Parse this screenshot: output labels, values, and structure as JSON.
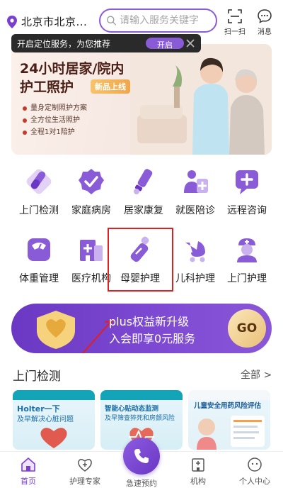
{
  "header": {
    "location": "北京市北京...",
    "search_placeholder": "请输入服务关键字",
    "scan_label": "扫一扫",
    "message_label": "消息"
  },
  "toast": {
    "text": "开启定位服务，为您推荐",
    "button_label": "开启"
  },
  "banner": {
    "title_line1": "24小时居家/院内",
    "title_line2": "护工照护",
    "badge": "新品上线",
    "bullets": [
      "量身定制照护方案",
      "全方位生活照护",
      "全程1对1陪护"
    ]
  },
  "services": [
    {
      "label": "上门检测",
      "icon": "test-tube-icon"
    },
    {
      "label": "家庭病房",
      "icon": "check-badge-icon"
    },
    {
      "label": "居家康复",
      "icon": "rehab-icon"
    },
    {
      "label": "就医陪诊",
      "icon": "escort-icon"
    },
    {
      "label": "远程咨询",
      "icon": "chat-plus-icon"
    },
    {
      "label": "体重管理",
      "icon": "scale-icon"
    },
    {
      "label": "医疗机构",
      "icon": "hospital-icon"
    },
    {
      "label": "母婴护理",
      "icon": "baby-bottle-icon"
    },
    {
      "label": "儿科护理",
      "icon": "stroller-icon"
    },
    {
      "label": "上门护理",
      "icon": "nurse-icon"
    }
  ],
  "plus_banner": {
    "line1": "plus权益新升级",
    "line2": "入会即享0元服务",
    "go_label": "GO"
  },
  "section": {
    "title": "上门检测",
    "more": "全部 >"
  },
  "cards": [
    {
      "title": "Holter一下",
      "subtitle": "及早解决心脏问题"
    },
    {
      "title": "智能心贴动态监测",
      "subtitle": "及早筛查猝死和房颤风险"
    },
    {
      "title": "儿童安全用药风险评估",
      "subtitle": ""
    }
  ],
  "nav": {
    "items": [
      "首页",
      "护理专家",
      "急速预约",
      "机构",
      "个人中心"
    ]
  },
  "colors": {
    "brand_purple": "#7a3fd1",
    "highlight_red": "#e02020"
  }
}
